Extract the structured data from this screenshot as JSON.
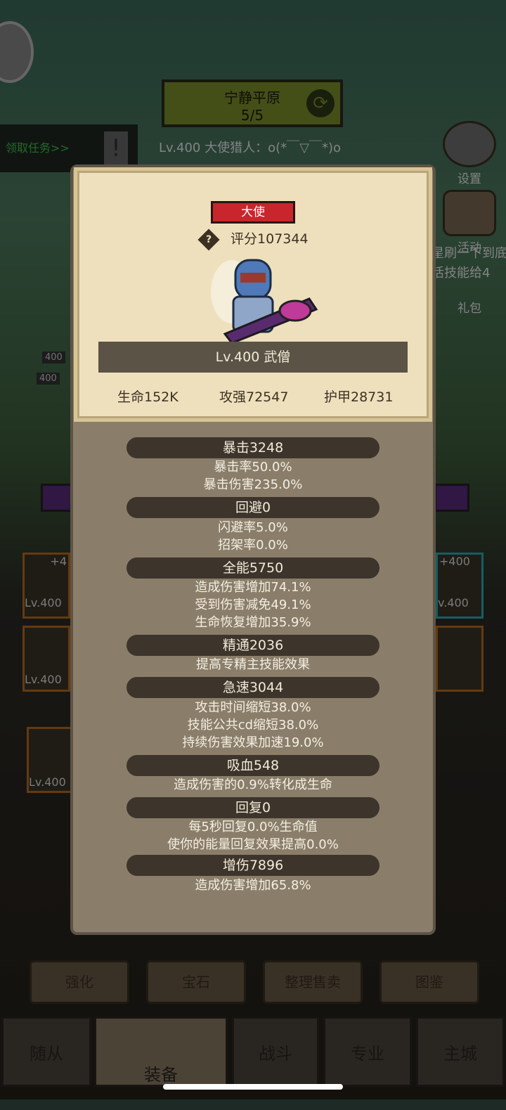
{
  "background": {
    "map_title": "宁静平原",
    "map_progress": "5/5",
    "task_button": "领取任务>>",
    "chat_line": "Lv.400 大使猎人：o(*￣▽￣*)o",
    "side_buttons": [
      "设置",
      "活动",
      "礼包"
    ],
    "scroll_text_1": "星刷一下到底",
    "scroll_text_2": "活技能给4",
    "level_tags": [
      "400",
      "400"
    ],
    "equip_slots": {
      "left_top_level": "Lv.400",
      "left_top_plus": "+4",
      "left_mid_level": "Lv.400",
      "right_top_level": "v.400",
      "right_top_plus": "+400",
      "bag_level": "Lv.400"
    },
    "tool_buttons": [
      "强化",
      "宝石",
      "整理售卖",
      "图鉴"
    ],
    "nav_tabs": [
      "随从",
      "装备",
      "战斗",
      "专业",
      "主城"
    ]
  },
  "popup": {
    "rank": "大使",
    "help_icon": "?",
    "score": "评分107344",
    "name": "Lv.400 武僧",
    "hp": "生命152K",
    "attack": "攻强72547",
    "armor": "护甲28731",
    "sections": [
      {
        "title": "暴击3248",
        "lines": [
          "暴击率50.0%",
          "暴击伤害235.0%"
        ]
      },
      {
        "title": "回避0",
        "lines": [
          "闪避率5.0%",
          "招架率0.0%"
        ]
      },
      {
        "title": "全能5750",
        "lines": [
          "造成伤害增加74.1%",
          "受到伤害减免49.1%",
          "生命恢复增加35.9%"
        ]
      },
      {
        "title": "精通2036",
        "lines": [
          "提高专精主技能效果"
        ]
      },
      {
        "title": "急速3044",
        "lines": [
          "攻击时间缩短38.0%",
          "技能公共cd缩短38.0%",
          "持续伤害效果加速19.0%"
        ]
      },
      {
        "title": "吸血548",
        "lines": [
          "造成伤害的0.9%转化成生命"
        ]
      },
      {
        "title": "回复0",
        "lines": [
          "每5秒回复0.0%生命值",
          "使你的能量回复效果提高0.0%"
        ]
      },
      {
        "title": "增伤7896",
        "lines": [
          "造成伤害增加65.8%"
        ]
      }
    ]
  },
  "colors": {
    "card_bg": "#efe0bd",
    "popup_bg": "#8a7e6a",
    "rank_red": "#c8262c",
    "category_bar": "#3d352c"
  }
}
